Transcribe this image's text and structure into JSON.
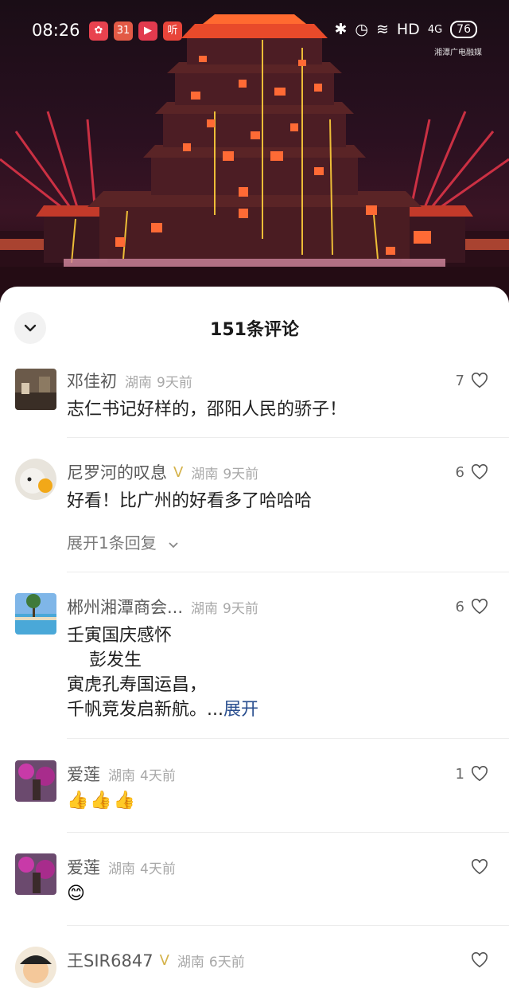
{
  "status_bar": {
    "time": "08:26",
    "apps": [
      {
        "icon": "app-pinwheel-icon",
        "glyph": "✿",
        "color": "#e8424f"
      },
      {
        "icon": "app-calendar-icon",
        "glyph": "31",
        "color": "#e25a46"
      },
      {
        "icon": "app-video-icon",
        "glyph": "▶",
        "color": "#e23a4e"
      },
      {
        "icon": "app-listen-icon",
        "glyph": "听",
        "color": "#e8453a"
      }
    ],
    "indicators": {
      "bluetooth": "✱",
      "alarm": "◷",
      "wifi": "≋",
      "hd": "HD",
      "signal": "4G",
      "battery": "76"
    }
  },
  "video": {
    "watermark": "湘潭广电融媒"
  },
  "comments_panel": {
    "title": "151条评论",
    "comments": [
      {
        "username": "邓佳初",
        "location": "湖南",
        "time": "9天前",
        "text": "志仁书记好样的，邵阳人民的骄子！",
        "likes": "7"
      },
      {
        "username": "尼罗河的叹息",
        "vip_icon": "Ⅴ",
        "location": "湖南",
        "time": "9天前",
        "text": "好看！比广州的好看多了哈哈哈",
        "likes": "6",
        "replies_label": "展开1条回复"
      },
      {
        "username": "郴州湘潭商会...",
        "location": "湖南",
        "time": "9天前",
        "text_lines": [
          "壬寅国庆感怀",
          "    彭发生",
          "寅虎孔寿国运昌，",
          "千帆竞发启新航。..."
        ],
        "expand_label": "展开",
        "likes": "6"
      },
      {
        "username": "爱莲",
        "location": "湖南",
        "time": "4天前",
        "emojis": [
          "👍",
          "👍",
          "👍"
        ],
        "likes": "1"
      },
      {
        "username": "爱莲",
        "location": "湖南",
        "time": "4天前",
        "emojis": [
          "😊"
        ],
        "likes": ""
      },
      {
        "username": "王SIR6847",
        "vip_icon": "Ⅴ",
        "location": "湖南",
        "time": "6天前",
        "likes": ""
      }
    ]
  }
}
